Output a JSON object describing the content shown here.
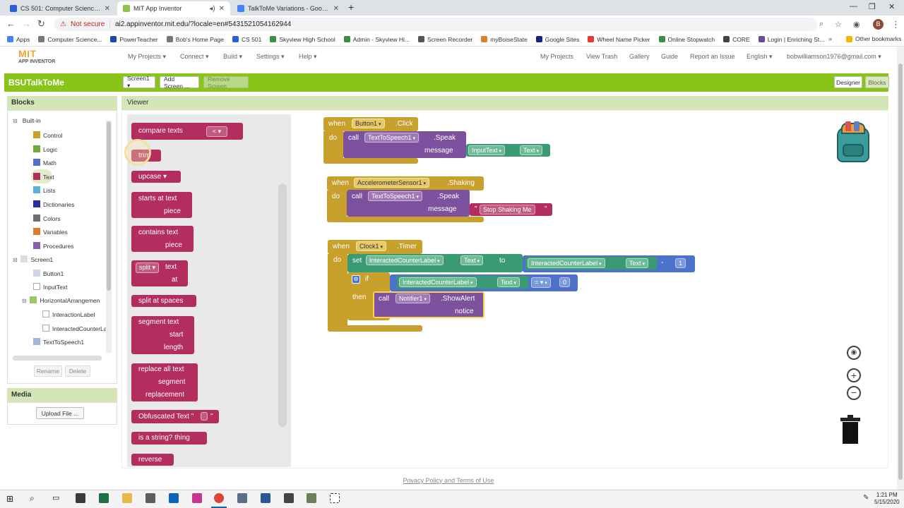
{
  "browser": {
    "tabs": [
      {
        "title": "CS 501: Computer Science Princ...",
        "color": "#2b5fd9"
      },
      {
        "title": "MIT App Inventor",
        "color": "#8bc34a"
      },
      {
        "title": "TalkToMe Variations - Google Do...",
        "color": "#4285f4"
      }
    ],
    "not_secure": "Not secure",
    "url": "ai2.appinventor.mit.edu/?locale=en#5431521054162944",
    "bookmarks": [
      "Apps",
      "Computer Science...",
      "PowerTeacher",
      "Bob's Home Page",
      "CS 501",
      "Skyview High School",
      "Admin - Skyview Hi...",
      "Screen Recorder",
      "myBoiseState",
      "Google Sites",
      "Wheel Name Picker",
      "Online Stopwatch",
      "CORE",
      "Login | Enriching St..."
    ],
    "other_bookmarks": "Other bookmarks",
    "profile": "B"
  },
  "appinventor": {
    "logo_mit": "MIT",
    "logo_sub": "APP INVENTOR",
    "menu_left": [
      "My Projects ▾",
      "Connect ▾",
      "Build ▾",
      "Settings ▾",
      "Help ▾"
    ],
    "menu_right": [
      "My Projects",
      "View Trash",
      "Gallery",
      "Guide",
      "Report an Issue",
      "English ▾",
      "bobwilliamson1976@gmail.com ▾"
    ],
    "project_name": "BSUTalkToMe",
    "screen_select": "Screen1 ▾",
    "add_screen": "Add Screen ...",
    "remove_screen": "Remove Screen",
    "designer": "Designer",
    "blocks_btn": "Blocks"
  },
  "blocks_panel": {
    "header": "Blocks",
    "builtin": "Built-in",
    "builtin_items": [
      {
        "label": "Control",
        "color": "#c8a02c"
      },
      {
        "label": "Logic",
        "color": "#6fab3b"
      },
      {
        "label": "Math",
        "color": "#4c73c9"
      },
      {
        "label": "Text",
        "color": "#b32d5e"
      },
      {
        "label": "Lists",
        "color": "#5ab0d8"
      },
      {
        "label": "Dictionaries",
        "color": "#2d2d9e"
      },
      {
        "label": "Colors",
        "color": "#6f6f6f"
      },
      {
        "label": "Variables",
        "color": "#e07a2c"
      },
      {
        "label": "Procedures",
        "color": "#8a5da8"
      }
    ],
    "screen": "Screen1",
    "components": [
      "Button1",
      "InputText",
      "HorizontalArrangemen",
      "InteractionLabel",
      "InteractedCounterLa",
      "TextToSpeech1"
    ],
    "rename": "Rename",
    "delete": "Delete",
    "media_header": "Media",
    "upload": "Upload File ..."
  },
  "viewer": {
    "header": "Viewer",
    "flyout": {
      "compare_texts": "compare texts",
      "compare_op": "< ▾",
      "trim": "trim",
      "upcase": "upcase ▾",
      "starts_at": "starts at  text",
      "piece": "piece",
      "contains": "contains  text",
      "split": "split ▾",
      "split_text": "text",
      "at": "at",
      "split_spaces": "split at spaces",
      "segment": "segment  text",
      "start": "start",
      "length": "length",
      "replace_all": "replace all  text",
      "replace_segment": "segment",
      "replacement": "replacement",
      "obfuscated": "Obfuscated Text \" ",
      "is_string": "is a string?  thing",
      "reverse": "reverse"
    },
    "event1": {
      "when": "when",
      "component": "Button1",
      "event": ".Click",
      "do": "do",
      "call": "call",
      "tts": "TextToSpeech1",
      "method": ".Speak",
      "message": "message",
      "arg_comp": "InputText",
      "arg_prop": "Text"
    },
    "event2": {
      "when": "when",
      "component": "AccelerometerSensor1",
      "event": ".Shaking",
      "do": "do",
      "call": "call",
      "tts": "TextToSpeech1",
      "method": ".Speak",
      "message": "message",
      "text": "Stop Shaking Me"
    },
    "event3": {
      "when": "when",
      "component": "Clock1",
      "event": ".Timer",
      "do": "do",
      "set": "set",
      "target": "InteractedCounterLabel",
      "prop": "Text",
      "to": "to",
      "src": "InteractedCounterLabel",
      "src_prop": "Text",
      "op": "-",
      "num": "1",
      "if": "if",
      "if_comp": "InteractedCounterLabel",
      "if_prop": "Text",
      "eq": "= ▾",
      "zero": "0",
      "then": "then",
      "call": "call",
      "notifier": "Notifier1",
      "method": ".ShowAlert",
      "notice": "notice"
    }
  },
  "footer": "Privacy Policy and Terms of Use",
  "taskbar": {
    "time": "1:21 PM",
    "date": "5/15/2020"
  }
}
